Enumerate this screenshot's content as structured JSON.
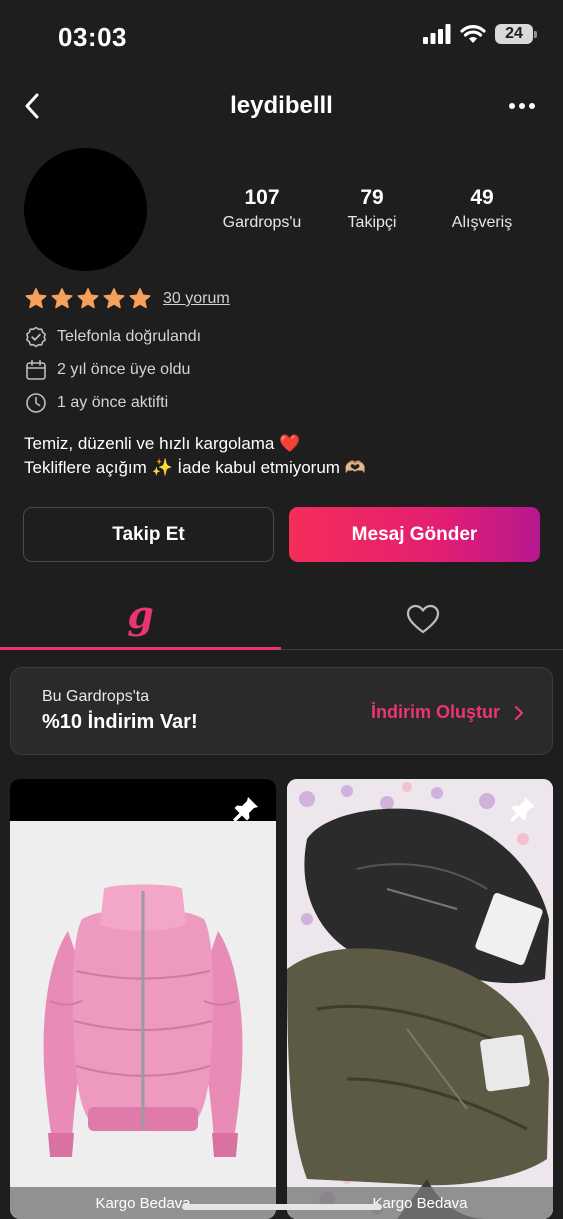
{
  "status_bar": {
    "time": "03:03",
    "battery": "24"
  },
  "nav": {
    "title": "leydibelll",
    "back_icon": "chevron-left-icon",
    "more_icon": "more-dots-icon"
  },
  "stats": [
    {
      "value": "107",
      "label": "Gardrops'u"
    },
    {
      "value": "79",
      "label": "Takipçi"
    },
    {
      "value": "49",
      "label": "Alışveriş"
    }
  ],
  "rating": {
    "stars": 5,
    "max_stars": 5,
    "reviews_label": "30 yorum",
    "star_color": "#f6a15a"
  },
  "info": [
    {
      "icon": "verified-badge-icon",
      "text": "Telefonla doğrulandı"
    },
    {
      "icon": "calendar-icon",
      "text": "2 yıl önce üye oldu"
    },
    {
      "icon": "clock-icon",
      "text": "1 ay önce aktifti"
    }
  ],
  "bio": {
    "line1": "Temiz, düzenli ve hızlı kargolama ❤️",
    "line2": "Tekliflere açığım ✨ İade kabul etmiyorum 🫶🏼"
  },
  "actions": {
    "follow_label": "Takip Et",
    "message_label": "Mesaj Gönder"
  },
  "tabs": {
    "wardrobe_icon": "g",
    "favorites_icon": "heart-icon",
    "accent": "#e9366e"
  },
  "discount": {
    "line1": "Bu Gardrops'ta",
    "line2": "%10 İndirim Var!",
    "cta": "İndirim Oluştur"
  },
  "products": [
    {
      "ribbon": "Kargo Bedava",
      "image": "pink-puffer-jacket",
      "pinned": true
    },
    {
      "ribbon": "Kargo Bedava",
      "image": "leather-jackets",
      "pinned": true
    }
  ]
}
